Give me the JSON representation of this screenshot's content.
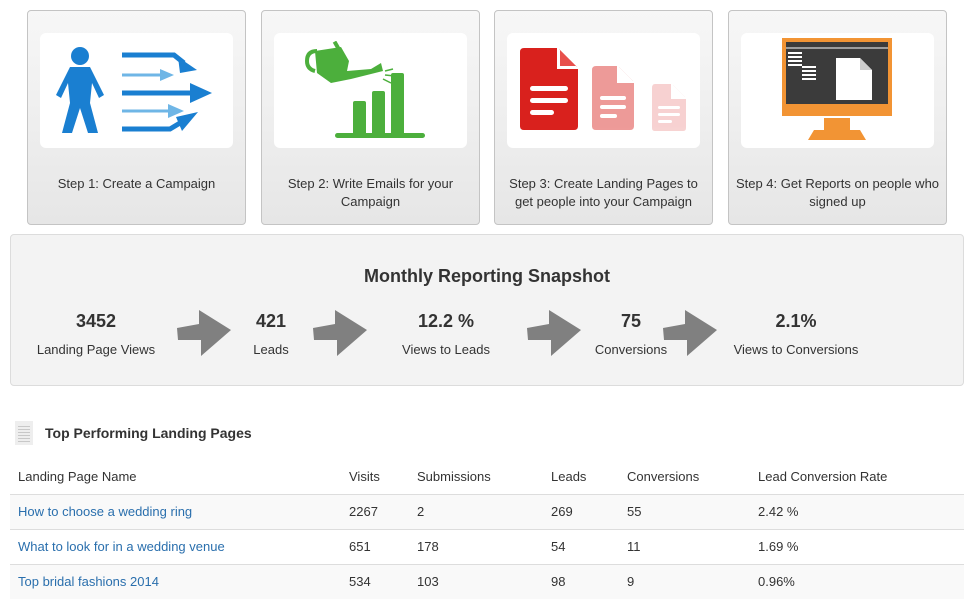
{
  "steps": [
    {
      "icon": "person-arrows-icon",
      "label": "Step 1: Create a Campaign"
    },
    {
      "icon": "watering-can-chart-icon",
      "label": "Step 2: Write Emails for your Campaign"
    },
    {
      "icon": "landing-pages-icon",
      "label": "Step 3: Create Landing Pages to get people into your Campaign"
    },
    {
      "icon": "monitor-report-icon",
      "label": "Step 4: Get Reports on people who signed up"
    }
  ],
  "snapshot": {
    "title": "Monthly Reporting Snapshot",
    "metrics": [
      {
        "value": "3452",
        "label": "Landing Page Views"
      },
      {
        "value": "421",
        "label": "Leads"
      },
      {
        "value": "12.2 %",
        "label": "Views to Leads"
      },
      {
        "value": "75",
        "label": "Conversions"
      },
      {
        "value": "2.1%",
        "label": "Views to Conversions"
      }
    ]
  },
  "top_pages": {
    "title": "Top Performing Landing Pages",
    "icon": "document-icon",
    "columns": [
      "Landing Page Name",
      "Visits",
      "Submissions",
      "Leads",
      "Conversions",
      "Lead Conversion Rate"
    ],
    "rows": [
      {
        "name": "How to choose a wedding ring",
        "visits": "2267",
        "submissions": "2",
        "leads": "269",
        "conversions": "55",
        "rate": "2.42 %"
      },
      {
        "name": "What to look for in a wedding venue",
        "visits": "651",
        "submissions": "178",
        "leads": "54",
        "conversions": "11",
        "rate": "1.69 %"
      },
      {
        "name": "Top bridal fashions 2014",
        "visits": "534",
        "submissions": "103",
        "leads": "98",
        "conversions": "9",
        "rate": "0.96%"
      }
    ]
  },
  "colors": {
    "step1_blue": "#1a7fd1",
    "step1_light_blue": "#6fb6e6",
    "step2_green": "#4caf3c",
    "step3_red": "#d9211d",
    "step4_orange": "#f29434",
    "link_blue": "#2a6fad",
    "arrow_gray": "#808080"
  }
}
